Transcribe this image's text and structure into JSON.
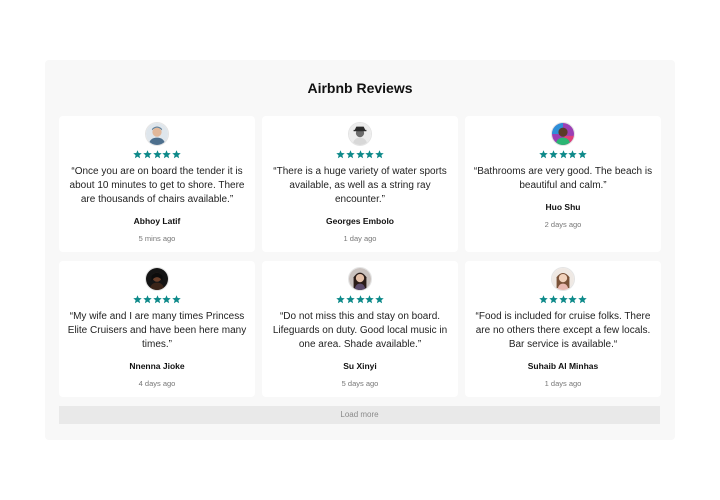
{
  "title": "Airbnb Reviews",
  "star_color": "#0e8a8a",
  "reviews": [
    {
      "text": "“Once you are on board the tender it is about 10 minutes to get to shore. There are thousands of chairs available.”",
      "name": "Abhoy Latif",
      "time": "5 mins ago",
      "rating": 5,
      "avatar": "man-with-cap"
    },
    {
      "text": "“There is a huge variety of water sports available, as well as a string ray encounter.”",
      "name": "Georges Embolo",
      "time": "1 day ago",
      "rating": 5,
      "avatar": "man-with-hat"
    },
    {
      "text": "“Bathrooms are very good. The beach is beautiful and calm.”",
      "name": "Huo Shu",
      "time": "2 days ago",
      "rating": 5,
      "avatar": "man-colorful-background"
    },
    {
      "text": "“My wife and I are many times Princess Elite Cruisers and have been here many times.”",
      "name": "Nnenna Jioke",
      "time": "4 days ago",
      "rating": 5,
      "avatar": "woman-dark-background"
    },
    {
      "text": "“Do not miss this and stay on board. Lifeguards on duty. Good local music in one area. Shade available.”",
      "name": "Su Xinyi",
      "time": "5 days ago",
      "rating": 5,
      "avatar": "woman-long-hair"
    },
    {
      "text": "“Food is included for cruise folks. There are no others there except a few locals. Bar service is available.“",
      "name": "Suhaib Al Minhas",
      "time": "1 days ago",
      "rating": 5,
      "avatar": "woman-smiling"
    }
  ],
  "load_more_label": "Load more"
}
